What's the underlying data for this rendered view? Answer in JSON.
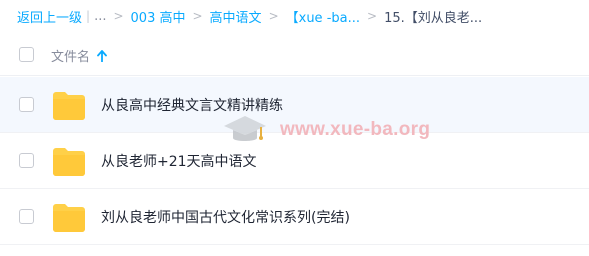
{
  "breadcrumb": {
    "back": "返回上一级",
    "separator_bar": "|",
    "ellipsis": "...",
    "arrow": ">",
    "items": [
      "003 高中",
      "高中语文",
      "【xue -ba..."
    ],
    "current": "15.【刘从良老..."
  },
  "header": {
    "title": "文件名",
    "sort_icon": "arrow-up-icon"
  },
  "files": [
    {
      "name": "从良高中经典文言文精讲精练",
      "icon": "folder-icon"
    },
    {
      "name": "从良老师+21天高中语文",
      "icon": "folder-icon"
    },
    {
      "name": "刘从良老师中国古代文化常识系列(完结)",
      "icon": "folder-icon"
    }
  ],
  "watermark": {
    "text": "www.xue-ba.org",
    "icon": "graduation-cap-icon"
  },
  "colors": {
    "accent": "#09aaff",
    "hover_row": "#f4f8fe",
    "folder": "#ffd048",
    "watermark": "#f2b8be"
  }
}
